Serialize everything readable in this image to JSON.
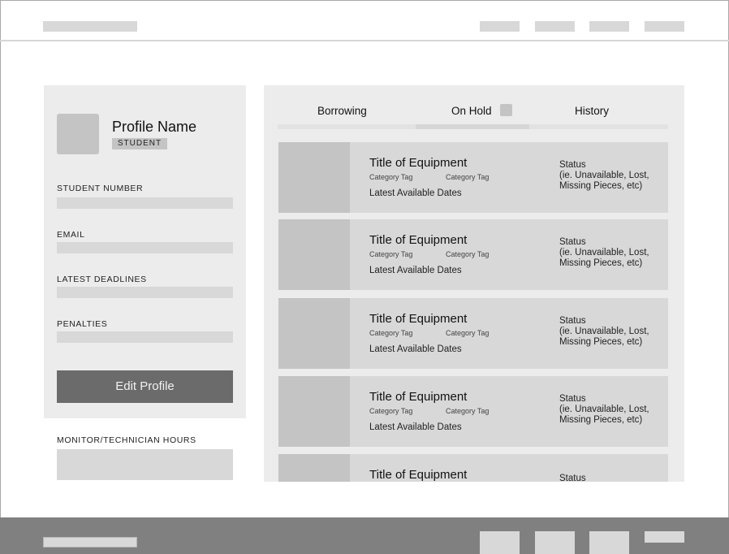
{
  "profile": {
    "name": "Profile Name",
    "role": "STUDENT",
    "fields": [
      {
        "label": "STUDENT NUMBER"
      },
      {
        "label": "EMAIL"
      },
      {
        "label": "LATEST DEADLINES"
      },
      {
        "label": "PENALTIES"
      }
    ],
    "edit_button": "Edit Profile",
    "hours_label": "MONITOR/TECHNICIAN HOURS"
  },
  "tabs": [
    {
      "label": "Borrowing",
      "active": false
    },
    {
      "label": "On Hold",
      "active": true
    },
    {
      "label": "History",
      "active": false
    }
  ],
  "items": [
    {
      "title": "Title of Equipment",
      "tag1": "Category Tag",
      "tag2": "Category Tag",
      "dates": "Latest Available Dates",
      "status": "Status",
      "status_detail": "(ie. Unavailable, Lost, Missing Pieces, etc)"
    },
    {
      "title": "Title of Equipment",
      "tag1": "Category Tag",
      "tag2": "Category Tag",
      "dates": "Latest Available Dates",
      "status": "Status",
      "status_detail": "(ie. Unavailable, Lost, Missing Pieces, etc)"
    },
    {
      "title": "Title of Equipment",
      "tag1": "Category Tag",
      "tag2": "Category Tag",
      "dates": "Latest Available Dates",
      "status": "Status",
      "status_detail": "(ie. Unavailable, Lost, Missing Pieces, etc)"
    },
    {
      "title": "Title of Equipment",
      "tag1": "Category Tag",
      "tag2": "Category Tag",
      "dates": "Latest Available Dates",
      "status": "Status",
      "status_detail": "(ie. Unavailable, Lost, Missing Pieces, etc)"
    },
    {
      "title": "Title of Equipment",
      "tag1": "",
      "tag2": "",
      "dates": "",
      "status": "Status",
      "status_detail": ""
    }
  ],
  "colors": {
    "card_bg": "#ececec",
    "placeholder": "#d8d8d8",
    "thumb": "#c4c4c4",
    "button": "#6b6b6b",
    "footer": "#808080"
  }
}
